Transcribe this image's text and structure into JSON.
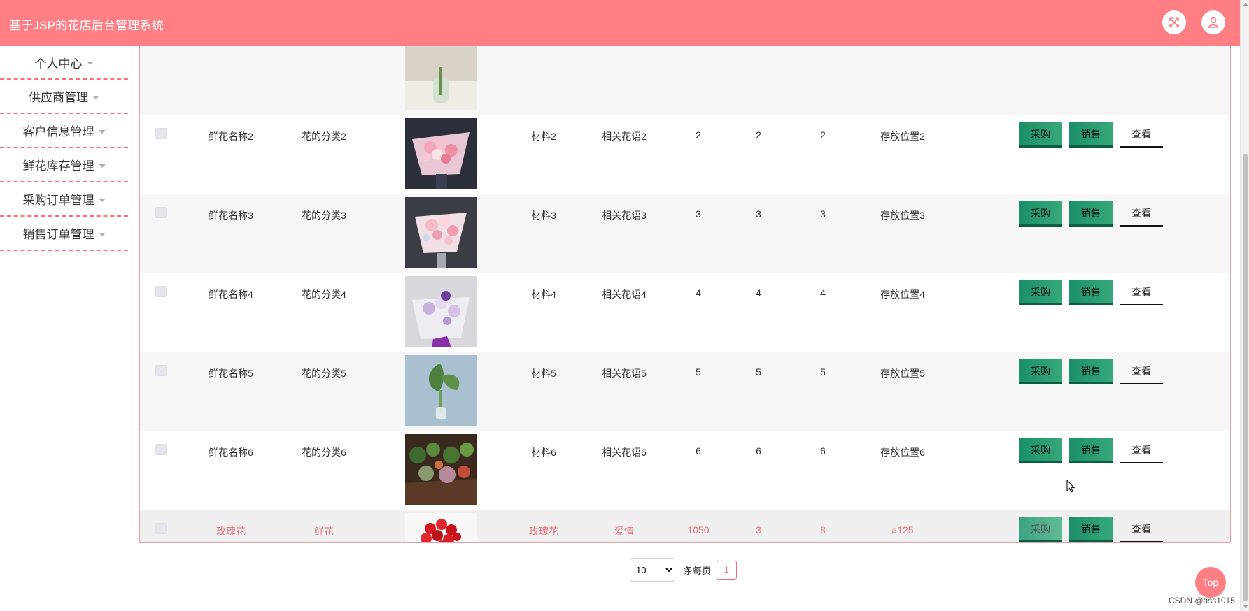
{
  "app": {
    "title": "基于JSP的花店后台管理系统"
  },
  "header": {
    "fullscreen_icon": "expand-icon",
    "user_icon": "user-icon"
  },
  "sidebar": {
    "items": [
      {
        "label": "个人中心"
      },
      {
        "label": "供应商管理"
      },
      {
        "label": "客户信息管理"
      },
      {
        "label": "鲜花库存管理"
      },
      {
        "label": "采购订单管理"
      },
      {
        "label": "销售订单管理"
      }
    ]
  },
  "table": {
    "actions": {
      "purchase": "采购",
      "sale": "销售",
      "view": "查看"
    },
    "rows": [
      {
        "name": "鲜花名称2",
        "category": "花的分类2",
        "material": "材料2",
        "language": "相关花语2",
        "c1": "2",
        "c2": "2",
        "c3": "2",
        "location": "存放位置2"
      },
      {
        "name": "鲜花名称3",
        "category": "花的分类3",
        "material": "材料3",
        "language": "相关花语3",
        "c1": "3",
        "c2": "3",
        "c3": "3",
        "location": "存放位置3"
      },
      {
        "name": "鲜花名称4",
        "category": "花的分类4",
        "material": "材料4",
        "language": "相关花语4",
        "c1": "4",
        "c2": "4",
        "c3": "4",
        "location": "存放位置4"
      },
      {
        "name": "鲜花名称5",
        "category": "花的分类5",
        "material": "材料5",
        "language": "相关花语5",
        "c1": "5",
        "c2": "5",
        "c3": "5",
        "location": "存放位置5"
      },
      {
        "name": "鲜花名称6",
        "category": "花的分类6",
        "material": "材料6",
        "language": "相关花语6",
        "c1": "6",
        "c2": "6",
        "c3": "6",
        "location": "存放位置6"
      },
      {
        "name": "玫瑰花",
        "category": "鲜花",
        "material": "玫瑰花",
        "language": "爱情",
        "c1": "1050",
        "c2": "3",
        "c3": "8",
        "location": "a125"
      }
    ]
  },
  "pagination": {
    "page_size": "10",
    "page_size_options": [
      "10"
    ],
    "per_page_label": "条每页",
    "current_page": "1"
  },
  "top_button": "Top",
  "watermark": "CSDN @ass1015",
  "colors": {
    "header": "#ff7f85",
    "accent": "#e8727c",
    "button_green": "#1b8f68"
  }
}
